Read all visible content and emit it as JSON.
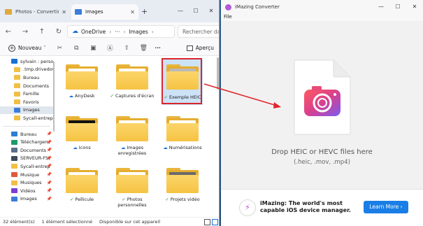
{
  "explorer": {
    "tabs": [
      {
        "label": "Photos - Convertir",
        "icon_color": "#e0a93a"
      },
      {
        "label": "Images",
        "icon_color": "#3b7dd8"
      }
    ],
    "address": {
      "location": "OneDrive",
      "ellipsis": "···",
      "current": "Images",
      "chevron": "›"
    },
    "search_placeholder": "Rechercher dan",
    "toolbar": {
      "new_label": "Nouveau",
      "preview_label": "Aperçu"
    },
    "sidebar": {
      "items": [
        {
          "label": "sylvain : personn",
          "color": "#1a6fd6",
          "selected": false,
          "pinned": false
        },
        {
          "label": ".tmp.drivedow",
          "color": "#f2bf45",
          "selected": false,
          "pinned": false
        },
        {
          "label": "Bureau",
          "color": "#f2bf45",
          "selected": false,
          "pinned": false
        },
        {
          "label": "Documents",
          "color": "#f2bf45",
          "selected": false,
          "pinned": false
        },
        {
          "label": "Famille",
          "color": "#f2bf45",
          "selected": false,
          "pinned": false
        },
        {
          "label": "Favoris",
          "color": "#f2bf45",
          "selected": false,
          "pinned": false
        },
        {
          "label": "Images",
          "color": "#3b7dd8",
          "selected": true,
          "pinned": false
        },
        {
          "label": "Sycall-entrepri",
          "color": "#f2bf45",
          "selected": false,
          "pinned": false
        }
      ],
      "quick": [
        {
          "label": "Bureau",
          "color": "#2d7fd2",
          "pinned": true
        },
        {
          "label": "Téléchargem",
          "color": "#1d9a6c",
          "pinned": true
        },
        {
          "label": "Documents",
          "color": "#5a6f8c",
          "pinned": true
        },
        {
          "label": "SERVEUR-FS\\",
          "color": "#3e4a5c",
          "pinned": true
        },
        {
          "label": "Sycall-entrep",
          "color": "#f2bf45",
          "pinned": true
        },
        {
          "label": "Musique",
          "color": "#e05a3c",
          "pinned": true
        },
        {
          "label": "Musiques",
          "color": "#f2bf45",
          "pinned": true
        },
        {
          "label": "Vidéos",
          "color": "#7b3fd1",
          "pinned": true
        },
        {
          "label": "Images",
          "color": "#3b7dd8",
          "pinned": true
        }
      ]
    },
    "items": [
      {
        "label": "AnyDesk",
        "status": "cloud",
        "paper": "#ffffff"
      },
      {
        "label": "Captures d'écran",
        "status": "ok",
        "paper": "#ffffff"
      },
      {
        "label": "Exemple HEIC",
        "status": "ok",
        "paper": "#b9b9b9",
        "selected": true
      },
      {
        "label": "Icons",
        "status": "cloud",
        "paper": "#111111"
      },
      {
        "label": "Images enregistrées",
        "status": "cloud",
        "paper": "#ffffff"
      },
      {
        "label": "Numérisations",
        "status": "cloud",
        "paper": "#ffffff"
      },
      {
        "label": "Pellicule",
        "status": "ok",
        "paper": "#ffffff"
      },
      {
        "label": "Photos personnelles",
        "status": "ok",
        "paper": "#ffffff"
      },
      {
        "label": "Projets vidéo",
        "status": "ok",
        "paper": "#6a6a6a"
      }
    ],
    "status": {
      "count": "32 élément(s)",
      "selected": "1 élément sélectionné",
      "availability": "Disponible sur cet appareil"
    }
  },
  "imazing": {
    "title": "iMazing Converter",
    "menu": "File",
    "drop_text": "Drop HEIC or HEVC files here",
    "drop_sub": "(.heic, .mov, .mp4)",
    "banner": {
      "line1": "iMazing: The world's most",
      "line2": "capable iOS device manager.",
      "button": "Learn More  ›"
    }
  }
}
